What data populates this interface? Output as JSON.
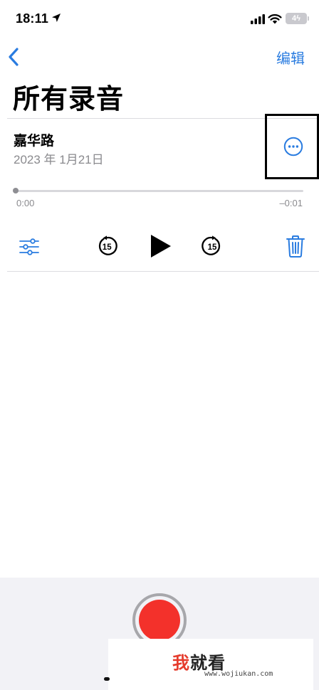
{
  "status_bar": {
    "time": "18:11",
    "battery": "4"
  },
  "nav": {
    "edit_label": "编辑"
  },
  "page": {
    "title": "所有录音"
  },
  "recording": {
    "name": "嘉华路",
    "date": "2023 年 1月21日",
    "elapsed": "0:00",
    "remaining": "–0:01",
    "progress": 0
  },
  "controls": {
    "skip_back_seconds": "15",
    "skip_forward_seconds": "15"
  },
  "watermark": {
    "first_char": "我",
    "rest": "就看",
    "url": "www.wojiukan.com"
  },
  "colors": {
    "accent": "#2a7ce0",
    "record": "#f3312b",
    "muted_text": "#8a8a8e"
  },
  "icons": [
    "location-arrow-icon",
    "cellular-signal-icon",
    "wifi-icon",
    "battery-icon",
    "chevron-left-icon",
    "more-ellipsis-icon",
    "equalizer-settings-icon",
    "skip-back-15-icon",
    "play-icon",
    "skip-forward-15-icon",
    "trash-icon",
    "record-icon"
  ]
}
